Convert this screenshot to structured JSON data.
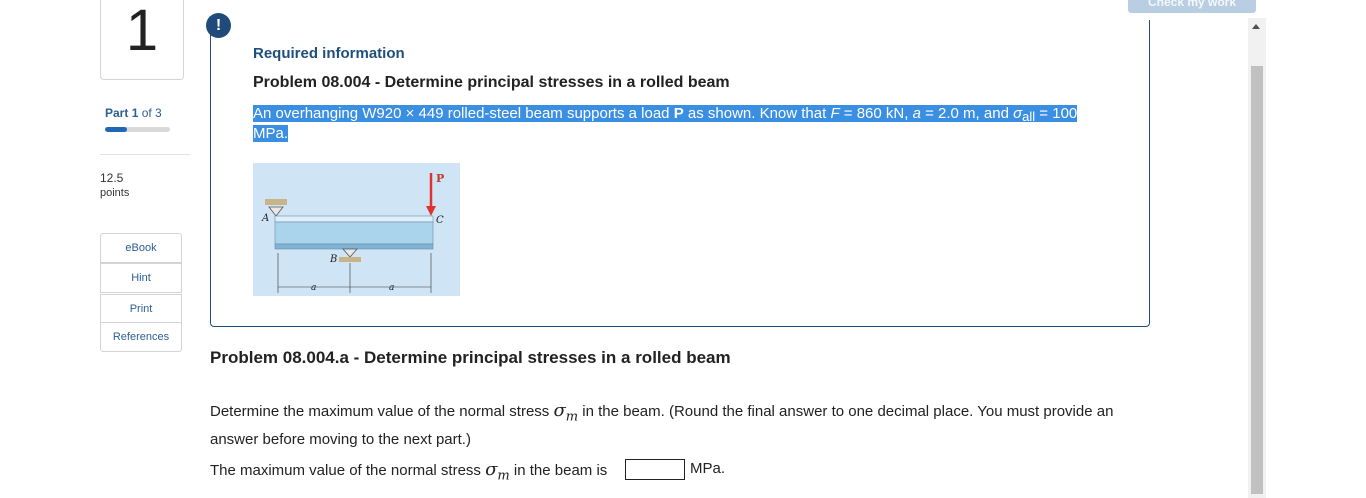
{
  "question_number": "1",
  "part": {
    "label": "Part",
    "current": "1",
    "of_text": "of 3",
    "progress_fraction": 0.333
  },
  "points": {
    "value": "12.5",
    "label": "points"
  },
  "resources": [
    {
      "label": "eBook"
    },
    {
      "label": "Hint"
    },
    {
      "label": "Print"
    },
    {
      "label": "References"
    }
  ],
  "header_button": {
    "label": "Check my work"
  },
  "info": {
    "badge": "!",
    "required_label": "Required information",
    "problem_title": "Problem 08.004 - Determine principal stresses in a rolled beam",
    "text_part1": "An overhanging W920 × 449 rolled-steel beam supports a load ",
    "load_symbol": "P",
    "text_part2": " as shown. Know that ",
    "F_symbol": "F",
    "F_value": " = 860 kN, ",
    "a_symbol": "a",
    "a_value": " = 2.0 m, and ",
    "sigma": "σ",
    "sigma_sub": "all",
    "sigma_value": " = 100 MPa."
  },
  "figure": {
    "labels": {
      "A": "A",
      "B": "B",
      "C": "C",
      "P": "P",
      "a1": "a",
      "a2": "a"
    },
    "colors": {
      "background": "#cfe4f4",
      "beam": "#a9d4ec",
      "load_arrow": "#e0322f"
    }
  },
  "part_a": {
    "title": "Problem 08.004.a - Determine principal stresses in a rolled beam",
    "question_part1": "Determine the maximum value of the normal stress ",
    "sigma": "σ",
    "sigma_sub": "m",
    "question_part2": " in the beam. (Round the final answer to one decimal place. You must provide an answer before moving to the next part.)",
    "answer_prefix": "The maximum value of the normal stress ",
    "answer_mid": " in the beam is",
    "answer_value": "",
    "unit": "MPa."
  }
}
